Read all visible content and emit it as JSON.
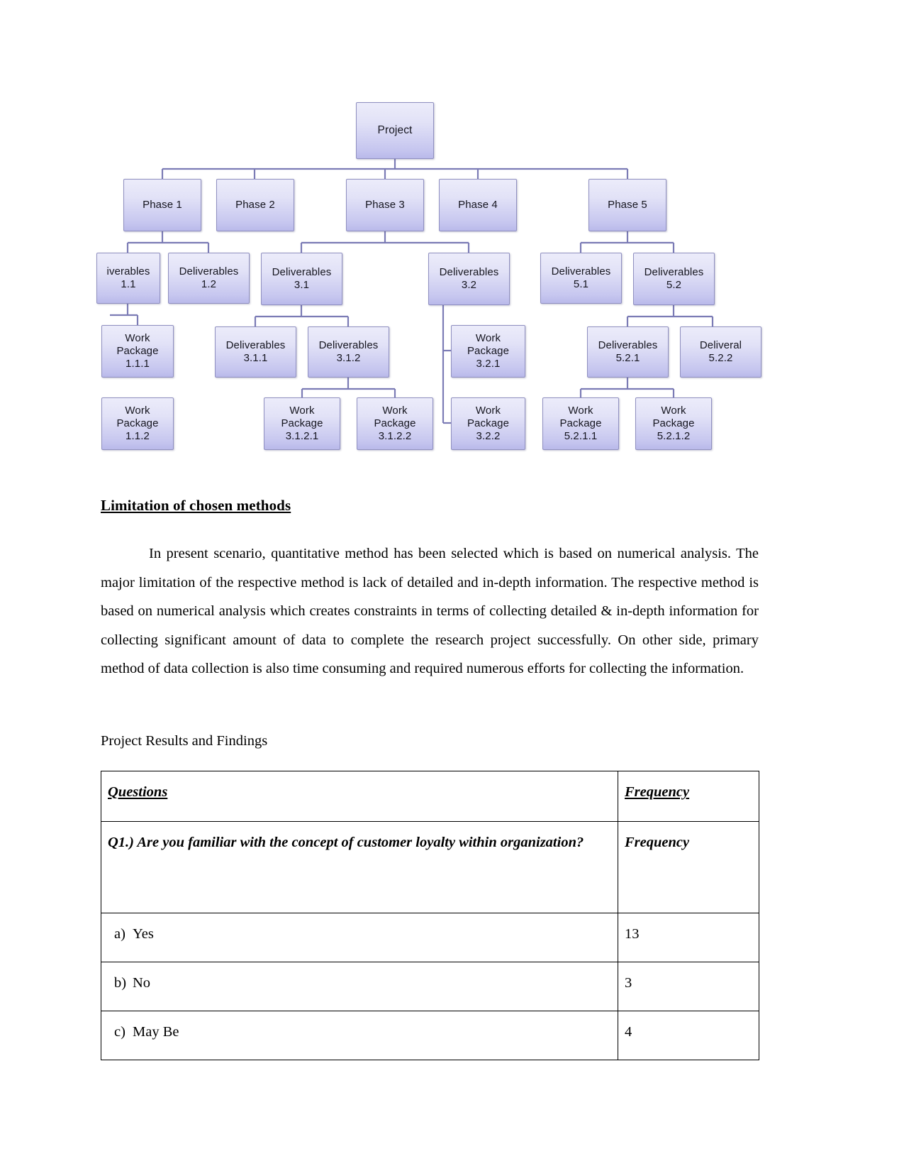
{
  "diagram": {
    "name": "work-breakdown-structure",
    "nodes": [
      {
        "id": "project",
        "label": "Project"
      },
      {
        "id": "phase1",
        "label": "Phase 1"
      },
      {
        "id": "phase2",
        "label": "Phase 2"
      },
      {
        "id": "phase3",
        "label": "Phase 3"
      },
      {
        "id": "phase4",
        "label": "Phase 4"
      },
      {
        "id": "phase5",
        "label": "Phase 5"
      },
      {
        "id": "d11",
        "label": "iverables\n1.1"
      },
      {
        "id": "d12",
        "label": "Deliverables\n1.2"
      },
      {
        "id": "d31",
        "label": "Deliverables\n3.1"
      },
      {
        "id": "d32",
        "label": "Deliverables\n3.2"
      },
      {
        "id": "d51",
        "label": "Deliverables\n5.1"
      },
      {
        "id": "d52",
        "label": "Deliverables\n5.2"
      },
      {
        "id": "wp111",
        "label": "Work\nPackage\n1.1.1"
      },
      {
        "id": "wp112",
        "label": "Work\nPackage\n1.1.2"
      },
      {
        "id": "d311",
        "label": "Deliverables\n3.1.1"
      },
      {
        "id": "d312",
        "label": "Deliverables\n3.1.2"
      },
      {
        "id": "wp3121",
        "label": "Work\nPackage\n3.1.2.1"
      },
      {
        "id": "wp3122",
        "label": "Work\nPackage\n3.1.2.2"
      },
      {
        "id": "wp321",
        "label": "Work\nPackage\n3.2.1"
      },
      {
        "id": "wp322",
        "label": "Work\nPackage\n3.2.2"
      },
      {
        "id": "d521",
        "label": "Deliverables\n5.2.1"
      },
      {
        "id": "d522",
        "label": "Deliveral\n5.2.2"
      },
      {
        "id": "wp5211",
        "label": "Work\nPackage\n5.2.1.1"
      },
      {
        "id": "wp5212",
        "label": "Work\nPackage\n5.2.1.2"
      }
    ]
  },
  "heading": "Limitation of chosen methods",
  "paragraph1": "In present scenario, quantitative method has been selected which is based on numerical analysis. The major limitation of the respective method is lack of detailed and in-depth information. The respective method is based on numerical analysis which creates constraints in terms of collecting detailed & in-depth information for collecting significant amount of data to complete the research project successfully. On other side, primary method of data collection is also time consuming and required numerous efforts for collecting the information.",
  "subheading": "Project Results and Findings",
  "table": {
    "headers": {
      "questions": "Questions",
      "frequency": "Frequency "
    },
    "question": {
      "text": "Q1.) Are you familiar with the concept of customer loyalty within organization?",
      "frequency_label": "Frequency"
    },
    "answers": [
      {
        "marker": "a)",
        "label": "Yes",
        "frequency": "13"
      },
      {
        "marker": "b)",
        "label": "No",
        "frequency": "3"
      },
      {
        "marker": "c)",
        "label": "May Be",
        "frequency": "4"
      }
    ]
  },
  "colors": {
    "node_border": "#8f8fc0",
    "node_fill_top": "#ececfa",
    "node_fill_bottom": "#b9b9ea",
    "connector": "#7b7bb5",
    "text": "#15151f",
    "table_border": "#000000"
  }
}
